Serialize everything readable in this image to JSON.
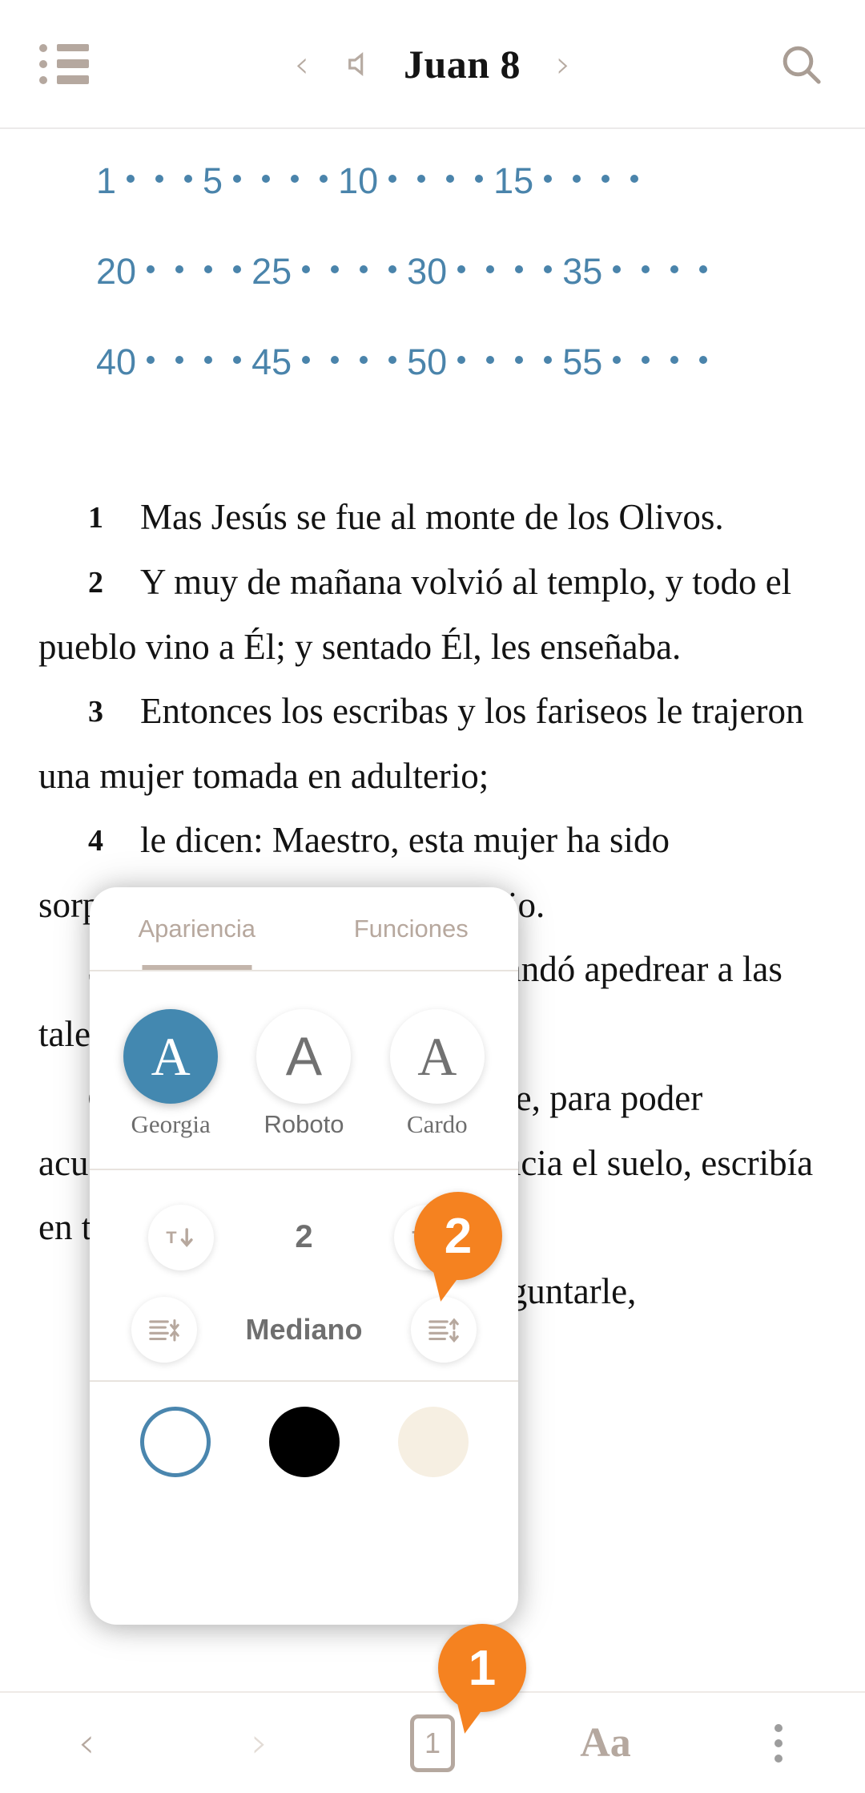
{
  "topbar": {
    "menu_icon": "list-icon",
    "prev_icon": "chevron-left-icon",
    "speaker_icon": "speaker-icon",
    "title": "Juan 8",
    "next_icon": "chevron-right-icon",
    "search_icon": "search-icon"
  },
  "verse_nav": {
    "rows": [
      {
        "marks": [
          "1",
          "·",
          "·",
          "·",
          "5",
          "·",
          "·",
          "·",
          "·",
          "10",
          "·",
          "·",
          "·",
          "·",
          "15",
          "·",
          "·",
          "·",
          "·"
        ]
      },
      {
        "marks": [
          "20",
          "·",
          "·",
          "·",
          "·",
          "25",
          "·",
          "·",
          "·",
          "·",
          "30",
          "·",
          "·",
          "·",
          "·",
          "35",
          "·",
          "·",
          "·",
          "·"
        ]
      },
      {
        "marks": [
          "40",
          "·",
          "·",
          "·",
          "·",
          "45",
          "·",
          "·",
          "·",
          "·",
          "50",
          "·",
          "·",
          "·",
          "·",
          "55",
          "·",
          "·",
          "·",
          "·"
        ]
      }
    ],
    "color": "#4a84ab"
  },
  "verses": [
    {
      "number": "1",
      "text": "Mas Jesús se fue al monte de los Olivos."
    },
    {
      "number": "2",
      "text": "Y muy de mañana volvió al templo, y todo el pueblo vino a Él; y sentado Él, les enseñaba."
    },
    {
      "number": "3",
      "text": "Entonces los escribas y los fariseos le trajeron una mujer tomada en adulterio;"
    },
    {
      "number": "4",
      "text": "le dicen: Maestro, esta mujer ha sido sorprendida en el acto de adulterio."
    },
    {
      "number": "5",
      "text": "Y en la ley Moisés nos mandó apedrear a las tales. Tú, pues, ¿qué dices?"
    },
    {
      "number": "6",
      "text": "Mas esto decían tentándole, para poder acusarle. Pero Jesús, inclinado hacia el suelo, escribía en tierra con el dedo."
    },
    {
      "number": "7",
      "text": "Y como insistieran en preguntarle,"
    }
  ],
  "panel": {
    "tabs": [
      {
        "label": "Apariencia",
        "active": true
      },
      {
        "label": "Funciones",
        "active": false
      }
    ],
    "fonts": [
      {
        "label": "Georgia",
        "glyph": "A",
        "selected": true
      },
      {
        "label": "Roboto",
        "glyph": "A",
        "selected": false
      },
      {
        "label": "Cardo",
        "glyph": "A",
        "selected": false
      }
    ],
    "size_control": {
      "decrease_icon": "text-decrease-icon",
      "value": "2",
      "increase_icon": "text-increase-icon"
    },
    "spacing_control": {
      "decrease_icon": "line-spacing-decrease-icon",
      "value": "Mediano",
      "increase_icon": "line-spacing-increase-icon"
    },
    "themes": [
      {
        "name": "white-theme",
        "color": "#ffffff",
        "selected": true
      },
      {
        "name": "black-theme",
        "color": "#000000",
        "selected": false
      },
      {
        "name": "sepia-theme",
        "color": "#f6efe2",
        "selected": false
      }
    ],
    "accent_selected": "#4388b0"
  },
  "badges": [
    {
      "id": "1",
      "label": "1",
      "color": "#f58220"
    },
    {
      "id": "2",
      "label": "2",
      "color": "#f58220"
    }
  ],
  "bottombar": {
    "prev_icon": "chevron-left-icon",
    "next_icon": "chevron-right-icon",
    "page_label": "1",
    "text_settings_label": "Aa",
    "more_icon": "kebab-menu-icon"
  }
}
